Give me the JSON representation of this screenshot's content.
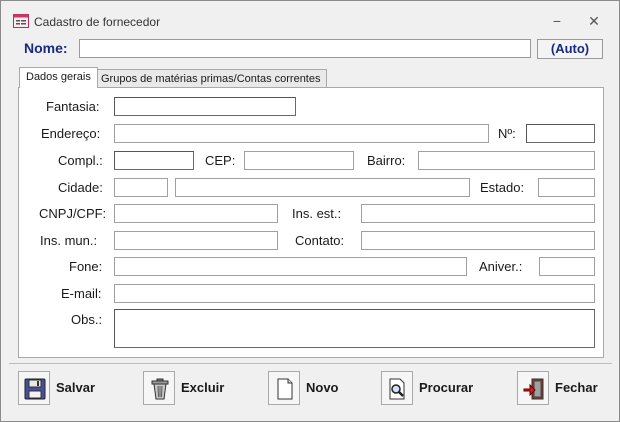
{
  "window": {
    "title": "Cadastro de fornecedor",
    "minimize": "−",
    "close": "✕"
  },
  "header": {
    "name_label": "Nome:",
    "name_value": "",
    "auto_button": "(Auto)"
  },
  "tabs": [
    {
      "label": "Dados gerais",
      "active": true
    },
    {
      "label": "Grupos de matérias primas/Contas correntes",
      "active": false
    }
  ],
  "form": {
    "fantasia": {
      "label": "Fantasia:",
      "value": ""
    },
    "endereco": {
      "label": "Endereço:",
      "value": ""
    },
    "numero": {
      "label": "Nº:",
      "value": ""
    },
    "compl": {
      "label": "Compl.:",
      "value": ""
    },
    "cep": {
      "label": "CEP:",
      "value": ""
    },
    "bairro": {
      "label": "Bairro:",
      "value": ""
    },
    "cidade": {
      "label": "Cidade:",
      "value": ""
    },
    "estado": {
      "label": "Estado:",
      "value": ""
    },
    "cnpj": {
      "label": "CNPJ/CPF:",
      "value": ""
    },
    "ins_est": {
      "label": "Ins. est.:",
      "value": ""
    },
    "ins_mun": {
      "label": "Ins. mun.:",
      "value": ""
    },
    "contato": {
      "label": "Contato:",
      "value": ""
    },
    "fone": {
      "label": "Fone:",
      "value": ""
    },
    "aniver": {
      "label": "Aniver.:",
      "value": ""
    },
    "email": {
      "label": "E-mail:",
      "value": ""
    },
    "obs": {
      "label": "Obs.:",
      "value": ""
    }
  },
  "buttons": [
    {
      "label": "Salvar",
      "icon": "floppy-disk-icon"
    },
    {
      "label": "Excluir",
      "icon": "trash-can-icon"
    },
    {
      "label": "Novo",
      "icon": "new-document-icon"
    },
    {
      "label": "Procurar",
      "icon": "search-document-icon"
    },
    {
      "label": "Fechar",
      "icon": "exit-door-icon"
    }
  ],
  "colors": {
    "accent_label": "#1a2a80",
    "window_bg": "#f0f0f0",
    "panel_bg": "#ffffff"
  }
}
